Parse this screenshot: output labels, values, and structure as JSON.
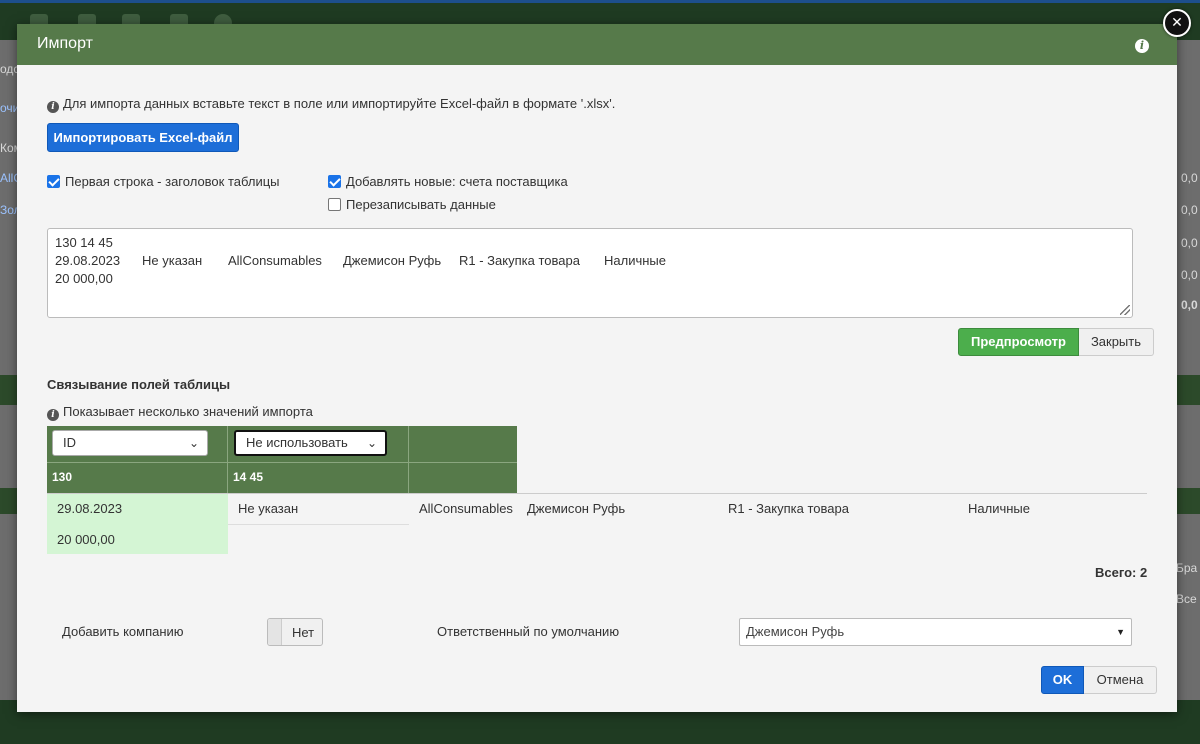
{
  "background": {
    "left_fragments": [
      "одс",
      "очи",
      "Ком",
      "AllC",
      "Зол"
    ],
    "right_fragments": [
      "0,0",
      "0,0",
      "0,0",
      "0,0",
      "0,0",
      "Бра",
      "Все"
    ]
  },
  "modal": {
    "title": "Импорт",
    "info_text": "Для импорта данных вставьте текст в поле или импортируйте Excel-файл в формате '.xlsx'.",
    "import_button": "Импортировать Excel-файл",
    "checkbox_header": {
      "label": "Первая строка - заголовок таблицы",
      "checked": true
    },
    "checkbox_add_new": {
      "label": "Добавлять новые: счета поставщика",
      "checked": true
    },
    "checkbox_overwrite": {
      "label": "Перезаписывать данные",
      "checked": false
    },
    "textarea_lines": [
      [
        "130  14 45"
      ],
      [
        "29.08.2023",
        "Не указан",
        "AllConsumables",
        "Джемисон Руфь",
        "R1 - Закупка товара",
        "Наличные"
      ],
      [
        "20 000,00"
      ]
    ],
    "preview_button": "Предпросмотр",
    "close_button": "Закрыть",
    "mapping_title": "Связывание полей таблицы",
    "mapping_hint": "Показывает несколько значений импорта",
    "mapping_columns": [
      {
        "select": "ID",
        "header": "130"
      },
      {
        "select": "Не использовать",
        "header": "14 45"
      }
    ],
    "preview_rows": [
      [
        "29.08.2023",
        "Не указан",
        "AllConsumables",
        "Джемисон Руфь",
        "R1 - Закупка товара",
        "Наличные"
      ],
      [
        "20 000,00"
      ]
    ],
    "total_label": "Всего: 2",
    "add_company_label": "Добавить компанию",
    "add_company_toggle": "Нет",
    "responsible_label": "Ответственный по умолчанию",
    "responsible_value": "Джемисон Руфь",
    "ok_button": "OK",
    "cancel_button": "Отмена"
  },
  "colors": {
    "header_green": "#567a4a",
    "preview_green": "#4cae4c",
    "primary_blue": "#1d6ed8",
    "highlight_cell": "#d4f5d4"
  },
  "icons": [
    "info-icon",
    "close-icon",
    "chevron-down-icon",
    "caret-down-icon"
  ]
}
